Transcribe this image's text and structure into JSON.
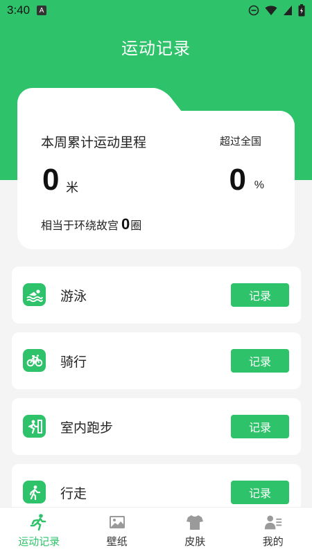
{
  "status_bar": {
    "time": "3:40",
    "badge": "A"
  },
  "header": {
    "title": "运动记录"
  },
  "summary": {
    "title": "本周累计运动里程",
    "distance_value": "0",
    "distance_unit": "米",
    "rank_title": "超过全国",
    "rank_value": "0",
    "rank_unit": "%",
    "equiv_prefix": "相当于环绕故宫",
    "equiv_value": "0",
    "equiv_suffix": "圈"
  },
  "activities": [
    {
      "label": "游泳",
      "button": "记录",
      "icon": "swimming-icon"
    },
    {
      "label": "骑行",
      "button": "记录",
      "icon": "bicycle-icon"
    },
    {
      "label": "室内跑步",
      "button": "记录",
      "icon": "indoor-running-icon"
    },
    {
      "label": "行走",
      "button": "记录",
      "icon": "walking-icon"
    }
  ],
  "tabs": [
    {
      "label": "运动记录",
      "icon": "running-icon",
      "active": true
    },
    {
      "label": "壁纸",
      "icon": "image-icon",
      "active": false
    },
    {
      "label": "皮肤",
      "icon": "tshirt-icon",
      "active": false
    },
    {
      "label": "我的",
      "icon": "profile-icon",
      "active": false
    }
  ],
  "colors": {
    "accent": "#2ec36a",
    "inactive_icon": "#9a9a9a"
  }
}
